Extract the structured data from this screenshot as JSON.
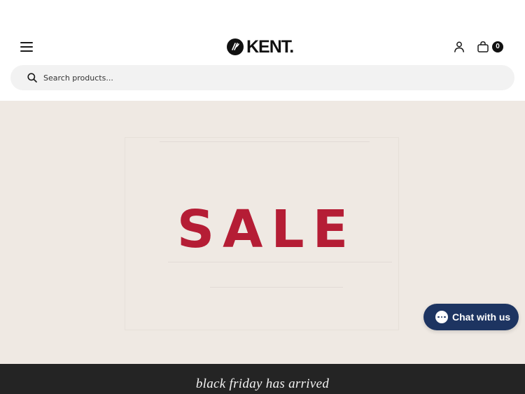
{
  "header": {
    "logo_text": "KENT.",
    "cart_count": "0"
  },
  "search": {
    "placeholder": "Search products..."
  },
  "hero": {
    "headline": "SALE",
    "headline_color": "#b51d35",
    "background_color": "#efe9e3"
  },
  "chat": {
    "label": "Chat with us",
    "color": "#1d3461"
  },
  "banner": {
    "text": "black friday has arrived",
    "background_color": "#242424"
  },
  "icons": [
    "hamburger-menu-icon",
    "kent-logo-mark-icon",
    "user-icon",
    "shopping-bag-icon",
    "search-icon",
    "chat-bubble-icon"
  ]
}
